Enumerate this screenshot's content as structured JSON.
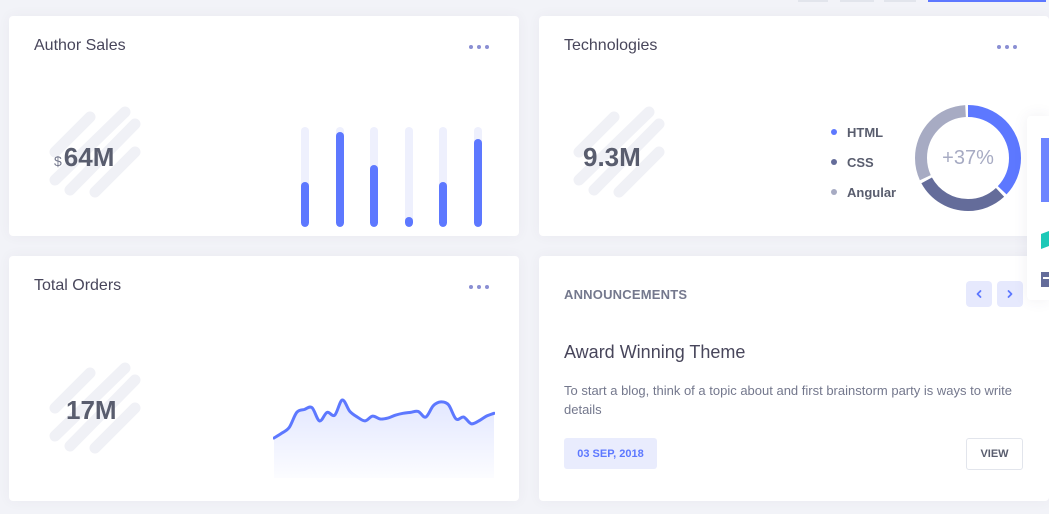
{
  "author_sales": {
    "title": "Author Sales",
    "currency": "$",
    "value": "64M",
    "bars": [
      0.45,
      0.95,
      0.62,
      0.1,
      0.45,
      0.88
    ]
  },
  "technologies": {
    "title": "Technologies",
    "value": "9.3M",
    "donut_label": "+37%",
    "legend": [
      {
        "label": "HTML",
        "color": "#5d78ff",
        "share": 0.38
      },
      {
        "label": "CSS",
        "color": "#646c9a",
        "share": 0.3
      },
      {
        "label": "Angular",
        "color": "#a7abc3",
        "share": 0.32
      }
    ]
  },
  "total_orders": {
    "title": "Total Orders",
    "value": "17M",
    "chart_data": {
      "type": "area",
      "values": [
        0,
        5,
        11,
        27,
        30,
        32,
        18,
        27,
        24,
        40,
        28,
        22,
        18,
        23,
        20,
        21,
        24,
        26,
        27,
        28,
        22,
        34,
        38,
        35,
        20,
        22,
        15,
        18,
        23,
        26
      ],
      "ylim": [
        0,
        60
      ],
      "color": "#5d78ff"
    }
  },
  "announcements": {
    "label": "ANNOUNCEMENTS",
    "title": "Award Winning Theme",
    "text": "To start a blog, think of a topic about and first brainstorm party is ways to write details",
    "date": "03 SEP, 2018",
    "view_label": "VIEW"
  },
  "icons": {
    "menu": "more-horizontal-icon",
    "prev": "chevron-left-icon",
    "next": "chevron-right-icon"
  },
  "colors": {
    "accent": "#5d78ff",
    "background": "#f2f3f8"
  }
}
